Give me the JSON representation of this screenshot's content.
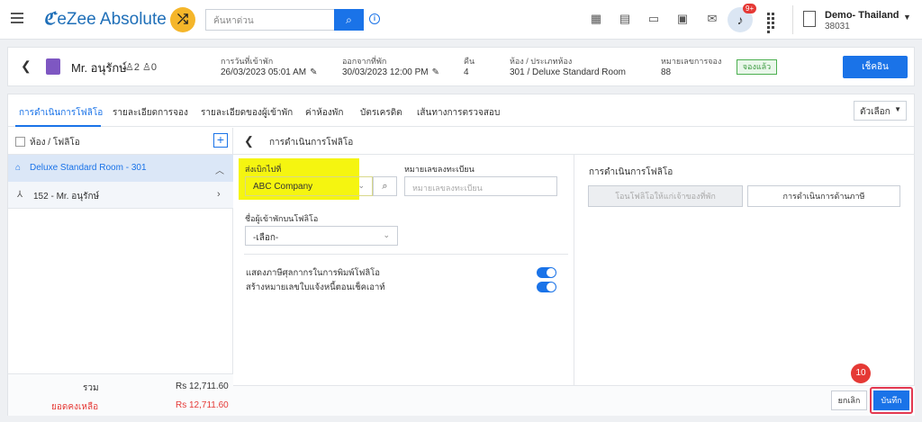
{
  "topbar": {
    "logo": "eZee Absolute",
    "search_placeholder": "ค้นหาด่วน",
    "notification_count": "9+",
    "hotel_name": "Demo- Thailand",
    "hotel_code": "38031"
  },
  "guest": {
    "name": "Mr. อนุรักษ์",
    "adults": "2",
    "children": "0",
    "checkin_label": "การวันที่เข้าพัก",
    "checkin_value": "26/03/2023 05:01 AM",
    "checkout_label": "ออกจากที่พัก",
    "checkout_value": "30/03/2023 12:00 PM",
    "nights_label": "คืน",
    "nights_value": "4",
    "room_label": "ห้อง / ประเภทห้อง",
    "room_value": "301 / Deluxe Standard Room",
    "reservation_label": "หมายเลขการจอง",
    "reservation_value": "88",
    "status": "จองแล้ว",
    "checkout_button": "เช็คอิน"
  },
  "tabs": [
    "การดำเนินการโฟลิโอ",
    "รายละเอียดการจอง",
    "รายละเอียดของผู้เข้าพัก",
    "ค่าห้องพัก",
    "บัตรเครดิต",
    "เส้นทางการตรวจสอบ"
  ],
  "options_label": "ตัวเลือก",
  "left_panel": {
    "title": "ห้อง / โฟลิโอ",
    "room": "Deluxe Standard Room - 301",
    "folio": "152 - Mr. อนุรักษ์",
    "total_label": "รวม",
    "total_value": "Rs 12,711.60",
    "balance_label": "ยอดคงเหลือ",
    "balance_value": "Rs 12,711.60"
  },
  "folio_ops": {
    "title": "การดำเนินการโฟลิโอ",
    "send_to_label": "ส่งเบิกไปที่",
    "send_to_value": "ABC Company",
    "reg_label": "หมายเลขลงทะเบียน",
    "reg_placeholder": "หมายเลขลงทะเบียน",
    "guest_on_folio_label": "ชื่อผู้เข้าพักบนโฟลิโอ",
    "guest_on_folio_value": "-เลือก-",
    "toggle1_label": "แสดงภาษีศุลกากรในการพิมพ์โฟลิโอ",
    "toggle2_label": "สร้างหมายเลขใบแจ้งหนี้ตอนเช็คเอาท์",
    "toggle1_on": true,
    "toggle2_on": true
  },
  "right_panel": {
    "title": "การดำเนินการโฟลิโอ",
    "transfer_button": "โอนโฟลิโอให้แก่เจ้าของที่พัก",
    "tax_button": "การดำเนินการด้านภาษี"
  },
  "footer": {
    "cancel": "ยกเลิก",
    "save": "บันทึก",
    "step": "10"
  }
}
